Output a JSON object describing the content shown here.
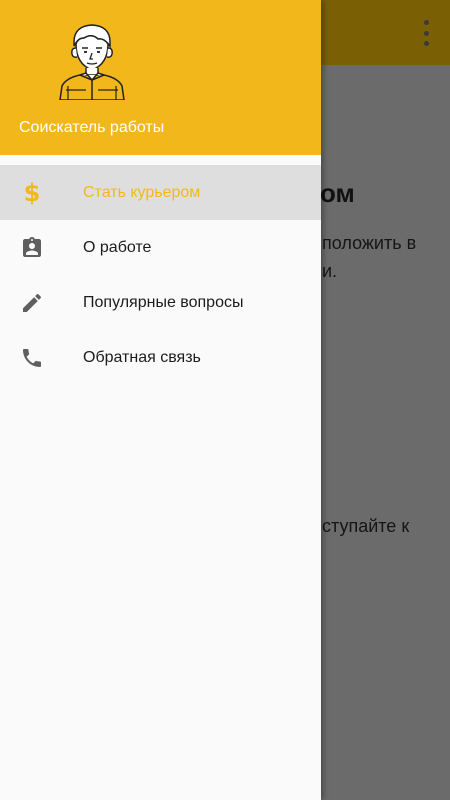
{
  "drawer": {
    "user_name": "Соискатель работы",
    "items": [
      {
        "label": "Стать курьером",
        "icon": "dollar-icon",
        "active": true
      },
      {
        "label": "О работе",
        "icon": "badge-icon",
        "active": false
      },
      {
        "label": "Популярные вопросы",
        "icon": "pencil-icon",
        "active": false
      },
      {
        "label": "Обратная связь",
        "icon": "phone-icon",
        "active": false
      }
    ]
  },
  "background": {
    "heading_fragment": "ом",
    "text_fragment_1": "положить в",
    "text_fragment_2": "и.",
    "text_fragment_3": "ступайте к"
  },
  "colors": {
    "accent": "#f2b81b",
    "active_item_bg": "#dedede",
    "scrim": "#6b6b6b"
  }
}
